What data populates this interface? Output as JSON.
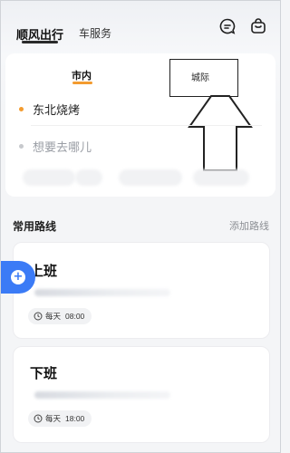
{
  "header": {
    "tabs": [
      {
        "label": "顺风出行",
        "active": true
      },
      {
        "label": "车服务",
        "active": false
      }
    ],
    "icons": [
      "chat-icon",
      "bag-icon"
    ]
  },
  "trip": {
    "segments": [
      {
        "label": "市内",
        "active": true
      },
      {
        "label": "城际",
        "active": false
      }
    ],
    "from": {
      "text": "东北烧烤"
    },
    "to": {
      "placeholder": "想要去哪儿"
    }
  },
  "routes": {
    "title": "常用路线",
    "add_label": "添加路线",
    "items": [
      {
        "name": "上班",
        "schedule": "每天",
        "time": "08:00"
      },
      {
        "name": "下班",
        "schedule": "每天",
        "time": "18:00"
      }
    ]
  },
  "colors": {
    "accent": "#f39b2f",
    "primary": "#3b7bf6",
    "card": "#ffffff",
    "background": "#f4f5f7"
  }
}
